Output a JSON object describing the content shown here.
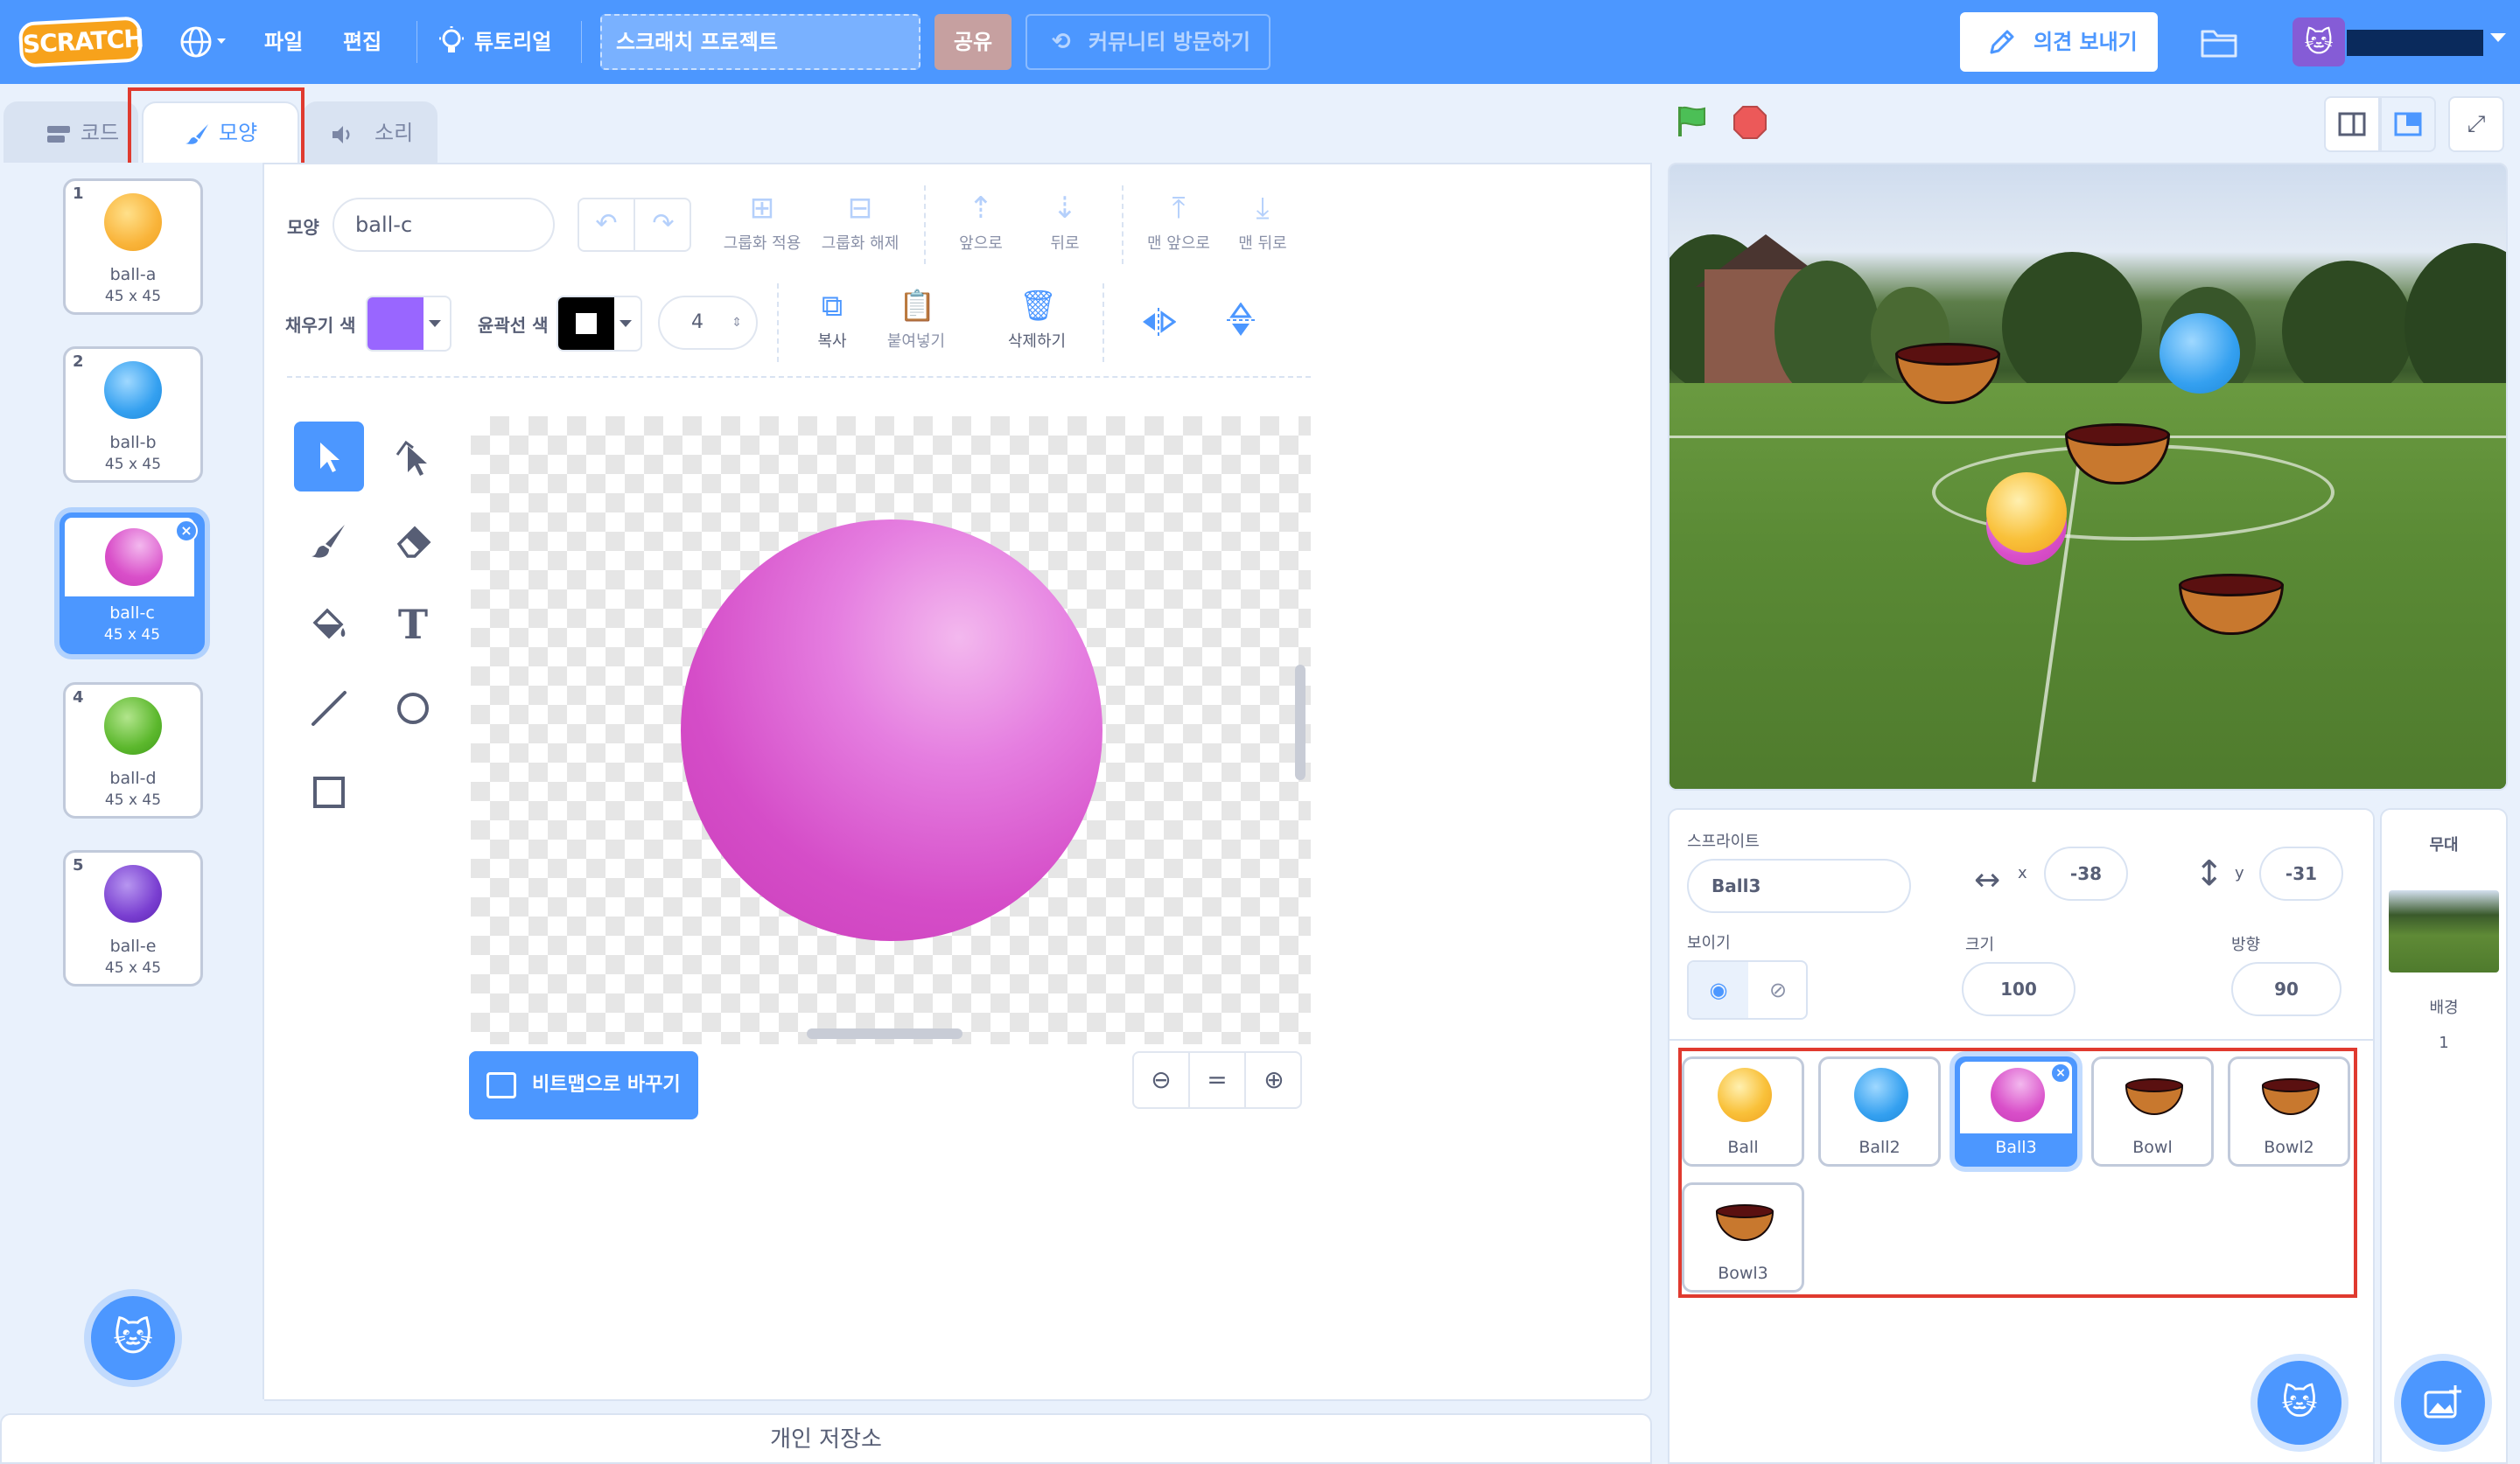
{
  "menubar": {
    "logo": "SCRATCH",
    "language_icon": "globe-icon",
    "file": "파일",
    "edit": "편집",
    "tutorials": "튜토리얼",
    "project_title": "스크래치 프로젝트",
    "share": "공유",
    "community": "커뮤니티 방문하기",
    "feedback": "의견 보내기"
  },
  "tabs": {
    "code": "코드",
    "costumes": "모양",
    "sounds": "소리"
  },
  "costumes": [
    {
      "num": "1",
      "name": "ball-a",
      "size": "45 x 45",
      "color": "#f9b43a"
    },
    {
      "num": "2",
      "name": "ball-b",
      "size": "45 x 45",
      "color": "#34a0f0"
    },
    {
      "num": "3",
      "name": "ball-c",
      "size": "45 x 45",
      "color": "#d94fc9"
    },
    {
      "num": "4",
      "name": "ball-d",
      "size": "45 x 45",
      "color": "#5cb82d"
    },
    {
      "num": "5",
      "name": "ball-e",
      "size": "45 x 45",
      "color": "#7a3fd1"
    }
  ],
  "paint": {
    "costume_label": "모양",
    "costume_name": "ball-c",
    "group": "그룹화 적용",
    "ungroup": "그룹화 해제",
    "forward": "앞으로",
    "backward": "뒤로",
    "front": "맨 앞으로",
    "back": "맨 뒤로",
    "fill_label": "채우기 색",
    "fill_color": "#9966ff",
    "outline_label": "윤곽선 색",
    "outline_color": "#000000",
    "stroke_width": "4",
    "copy": "복사",
    "paste": "붙여넣기",
    "delete": "삭제하기",
    "convert_bitmap": "비트맵으로 바꾸기",
    "zoom_reset": "="
  },
  "backpack": "개인 저장소",
  "sprite_info": {
    "sprite_label": "스프라이트",
    "sprite_name": "Ball3",
    "x_label": "x",
    "x": "-38",
    "y_label": "y",
    "y": "-31",
    "show_label": "보이기",
    "size_label": "크기",
    "size": "100",
    "direction_label": "방향",
    "direction": "90"
  },
  "sprites": [
    {
      "name": "Ball",
      "kind": "ball",
      "color": "#f9b43a"
    },
    {
      "name": "Ball2",
      "kind": "ball",
      "color": "#34a0f0"
    },
    {
      "name": "Ball3",
      "kind": "ball",
      "color": "#d94fc9"
    },
    {
      "name": "Bowl",
      "kind": "bowl"
    },
    {
      "name": "Bowl2",
      "kind": "bowl"
    },
    {
      "name": "Bowl3",
      "kind": "bowl"
    }
  ],
  "stage_panel": {
    "title": "무대",
    "backdrops_label": "배경",
    "backdrops_count": "1"
  }
}
